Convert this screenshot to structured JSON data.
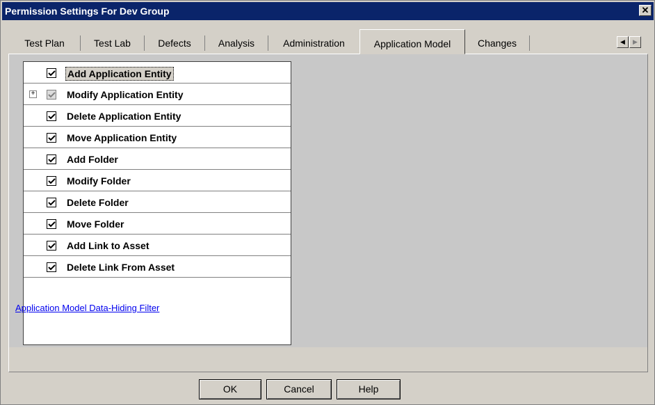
{
  "window": {
    "title": "Permission Settings For Dev Group",
    "close_label": "✕"
  },
  "tabs": [
    {
      "label": "Test Plan"
    },
    {
      "label": "Test Lab"
    },
    {
      "label": "Defects"
    },
    {
      "label": "Analysis"
    },
    {
      "label": "Administration"
    },
    {
      "label": "Application Model",
      "active": true
    },
    {
      "label": "Changes"
    }
  ],
  "tab_scroll": {
    "left": "◀",
    "right": "▶"
  },
  "permissions": [
    {
      "label": "Add Application Entity",
      "checked": true,
      "selected": true
    },
    {
      "label": "Modify Application Entity",
      "checked": true,
      "partial": true,
      "expandable": true,
      "expander": "+"
    },
    {
      "label": "Delete Application Entity",
      "checked": true
    },
    {
      "label": "Move Application Entity",
      "checked": true
    },
    {
      "label": "Add Folder",
      "checked": true
    },
    {
      "label": "Modify Folder",
      "checked": true
    },
    {
      "label": "Delete Folder",
      "checked": true
    },
    {
      "label": "Move Folder",
      "checked": true
    },
    {
      "label": "Add Link to Asset",
      "checked": true
    },
    {
      "label": "Delete Link From Asset",
      "checked": true
    }
  ],
  "filter_link": "Application Model Data-Hiding Filter",
  "buttons": {
    "ok": "OK",
    "cancel": "Cancel",
    "help": "Help"
  },
  "colors": {
    "titlebar": "#0a246a",
    "dialog_bg": "#d4d0c8",
    "link": "#0000ee"
  }
}
